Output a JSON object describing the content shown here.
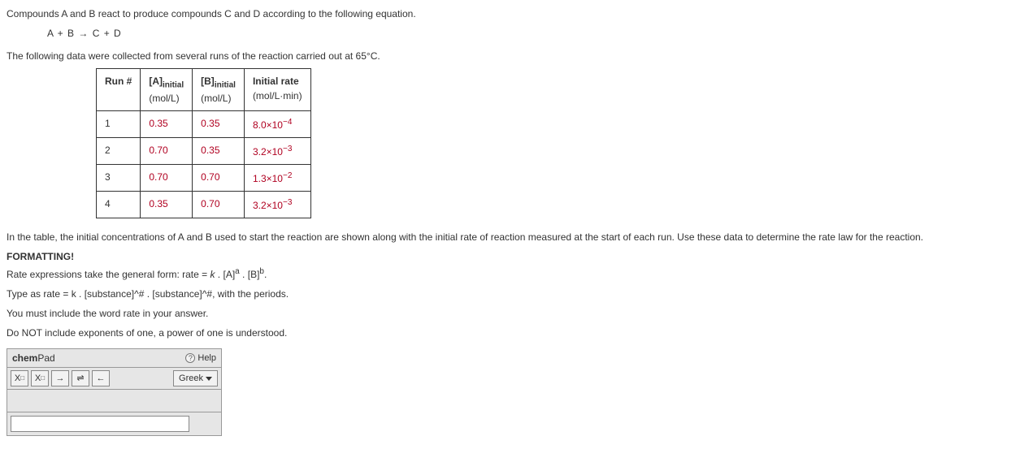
{
  "intro": {
    "line1": "Compounds A and B react to produce compounds C and D according to the following equation.",
    "equation": "A + B → C + D",
    "line2": "The following data were collected from several runs of the reaction carried out at 65°C."
  },
  "table": {
    "headers": {
      "run": "Run #",
      "a_label": "[A]",
      "a_sub": "initial",
      "a_unit": "(mol/L)",
      "b_label": "[B]",
      "b_sub": "initial",
      "b_unit": "(mol/L)",
      "rate_label": "Initial rate",
      "rate_unit": "(mol/L·min)"
    },
    "rows": [
      {
        "run": "1",
        "a": "0.35",
        "b": "0.35",
        "rate_base": "8.0×10",
        "rate_exp": "−4"
      },
      {
        "run": "2",
        "a": "0.70",
        "b": "0.35",
        "rate_base": "3.2×10",
        "rate_exp": "−3"
      },
      {
        "run": "3",
        "a": "0.70",
        "b": "0.70",
        "rate_base": "1.3×10",
        "rate_exp": "−2"
      },
      {
        "run": "4",
        "a": "0.35",
        "b": "0.70",
        "rate_base": "3.2×10",
        "rate_exp": "−3"
      }
    ]
  },
  "instructions": {
    "para": "In the table, the initial concentrations of A and B used to start the reaction are shown along with the initial rate of reaction measured at the start of each run. Use these data to determine the rate law for the reaction."
  },
  "formatting": {
    "title": "FORMATTING!",
    "line1_pre": "Rate expressions take the general form: rate = ",
    "k": "k",
    "dot": " . ",
    "a_base": "[A]",
    "a_exp": "a",
    "b_base": "[B]",
    "b_exp": "b",
    "period": ".",
    "line2": "Type as rate = k . [substance]^# . [substance]^#, with the periods.",
    "line3": "You must include the word rate in your answer.",
    "line4": "Do NOT include exponents of one, a power of one is understood."
  },
  "chempad": {
    "brand_bold": "chem",
    "brand_rest": "Pad",
    "help": "Help",
    "greek": "Greek",
    "sub_tool_x": "X",
    "sub_tool_box": "□",
    "sup_tool_x": "X",
    "sup_tool_box": "□",
    "arrow_right": "→",
    "arrow_equil": "⇌",
    "arrow_left": "←",
    "input_value": ""
  }
}
